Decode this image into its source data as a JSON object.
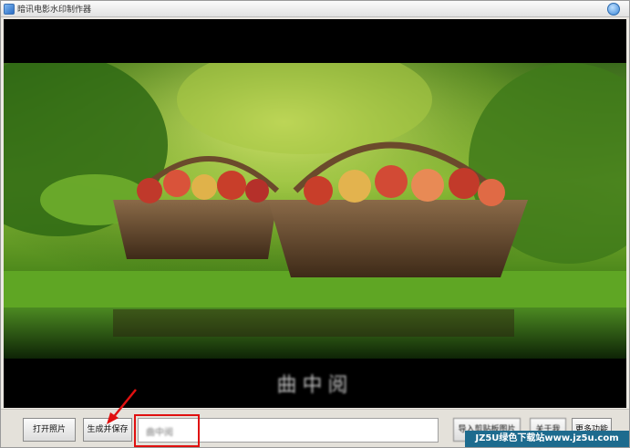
{
  "window": {
    "title": "暗讯电影水印制作器"
  },
  "preview": {
    "caption": "曲中阅"
  },
  "toolbar": {
    "open_photo_label": "打开照片",
    "generate_save_label": "生成并保存",
    "text_input_value": "曲中阅",
    "button3_label": "导入剪贴板图片",
    "button4_label": "关于我",
    "more_label": "更多功能"
  },
  "watermark": {
    "text": "JZ5U绿色下载站www.jz5u.com"
  },
  "colors": {
    "highlight": "#e01010",
    "watermark_bg": "#1d6b8e"
  }
}
